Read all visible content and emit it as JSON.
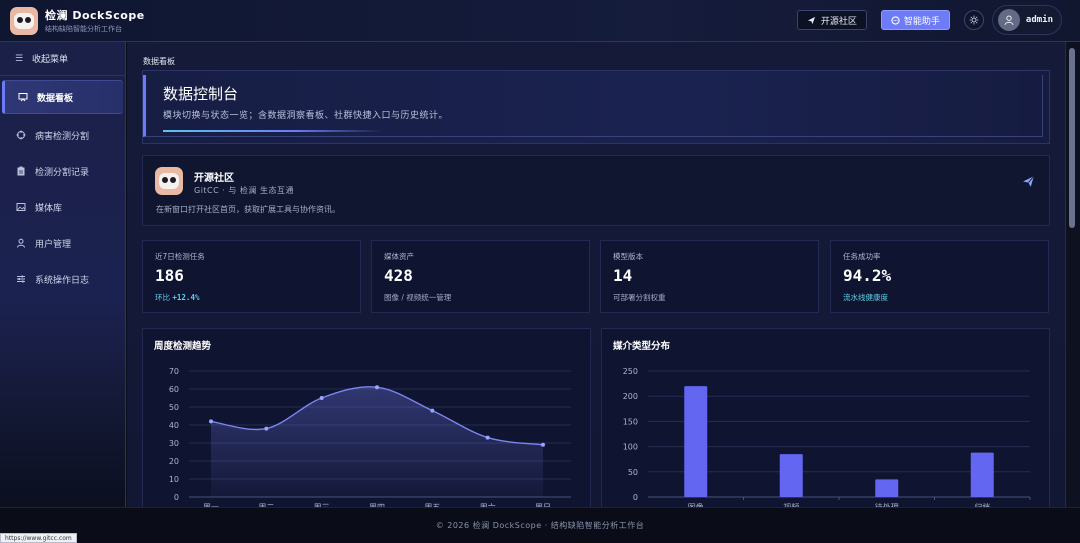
{
  "header": {
    "brand_title": "检澜 DockScope",
    "brand_subtitle": "结构缺陷智能分析工作台",
    "community_button": "开源社区",
    "assistant_button": "智能助手",
    "user_name": "admin"
  },
  "sidebar": {
    "collapse_label": "收起菜单",
    "items": [
      {
        "label": "数据看板",
        "icon": "dashboard-icon"
      },
      {
        "label": "病害检测分割",
        "icon": "crosshair-icon"
      },
      {
        "label": "检测分割记录",
        "icon": "clipboard-icon"
      },
      {
        "label": "媒体库",
        "icon": "image-icon"
      },
      {
        "label": "用户管理",
        "icon": "user-icon"
      },
      {
        "label": "系统操作日志",
        "icon": "sliders-icon"
      }
    ]
  },
  "main": {
    "section_label": "数据看板",
    "hero": {
      "title": "数据控制台",
      "subtitle": "模块切换与状态一览；含数据洞察看板、社群快捷入口与历史统计。"
    },
    "community": {
      "title": "开源社区",
      "subtitle": "GitCC · 与 检澜 生态互通",
      "description": "在新窗口打开社区首页，获取扩展工具与协作资讯。"
    },
    "stats": [
      {
        "label": "近7日检测任务",
        "value": "186",
        "note_prefix": "环比 ",
        "note_value": "+12.4%"
      },
      {
        "label": "媒体资产",
        "value": "428",
        "note": "图像 / 视频统一管理"
      },
      {
        "label": "模型版本",
        "value": "14",
        "note": "可部署分割权重"
      },
      {
        "label": "任务成功率",
        "value": "94.2%",
        "note": "流水线健康度"
      }
    ],
    "weekly_chart_title": "周度检测趋势",
    "media_chart_title": "媒介类型分布"
  },
  "chart_data": [
    {
      "type": "line",
      "title": "周度检测趋势",
      "categories": [
        "周一",
        "周二",
        "周三",
        "周四",
        "周五",
        "周六",
        "周日"
      ],
      "values": [
        42,
        38,
        55,
        61,
        48,
        33,
        29
      ],
      "ylim": [
        0,
        70
      ],
      "yticks": [
        0,
        10,
        20,
        30,
        40,
        50,
        60,
        70
      ],
      "grid": true,
      "color": "#7b86f0"
    },
    {
      "type": "bar",
      "title": "媒介类型分布",
      "categories": [
        "图像",
        "视频",
        "待处理",
        "归档"
      ],
      "values": [
        220,
        85,
        35,
        88
      ],
      "ylim": [
        0,
        250
      ],
      "yticks": [
        0,
        50,
        100,
        150,
        200,
        250
      ],
      "grid": true,
      "color": "#6266f0"
    }
  ],
  "footer": {
    "text": "© 2026 检澜 DockScope · 结构缺陷智能分析工作台"
  },
  "status_url": "https://www.gitcc.com"
}
